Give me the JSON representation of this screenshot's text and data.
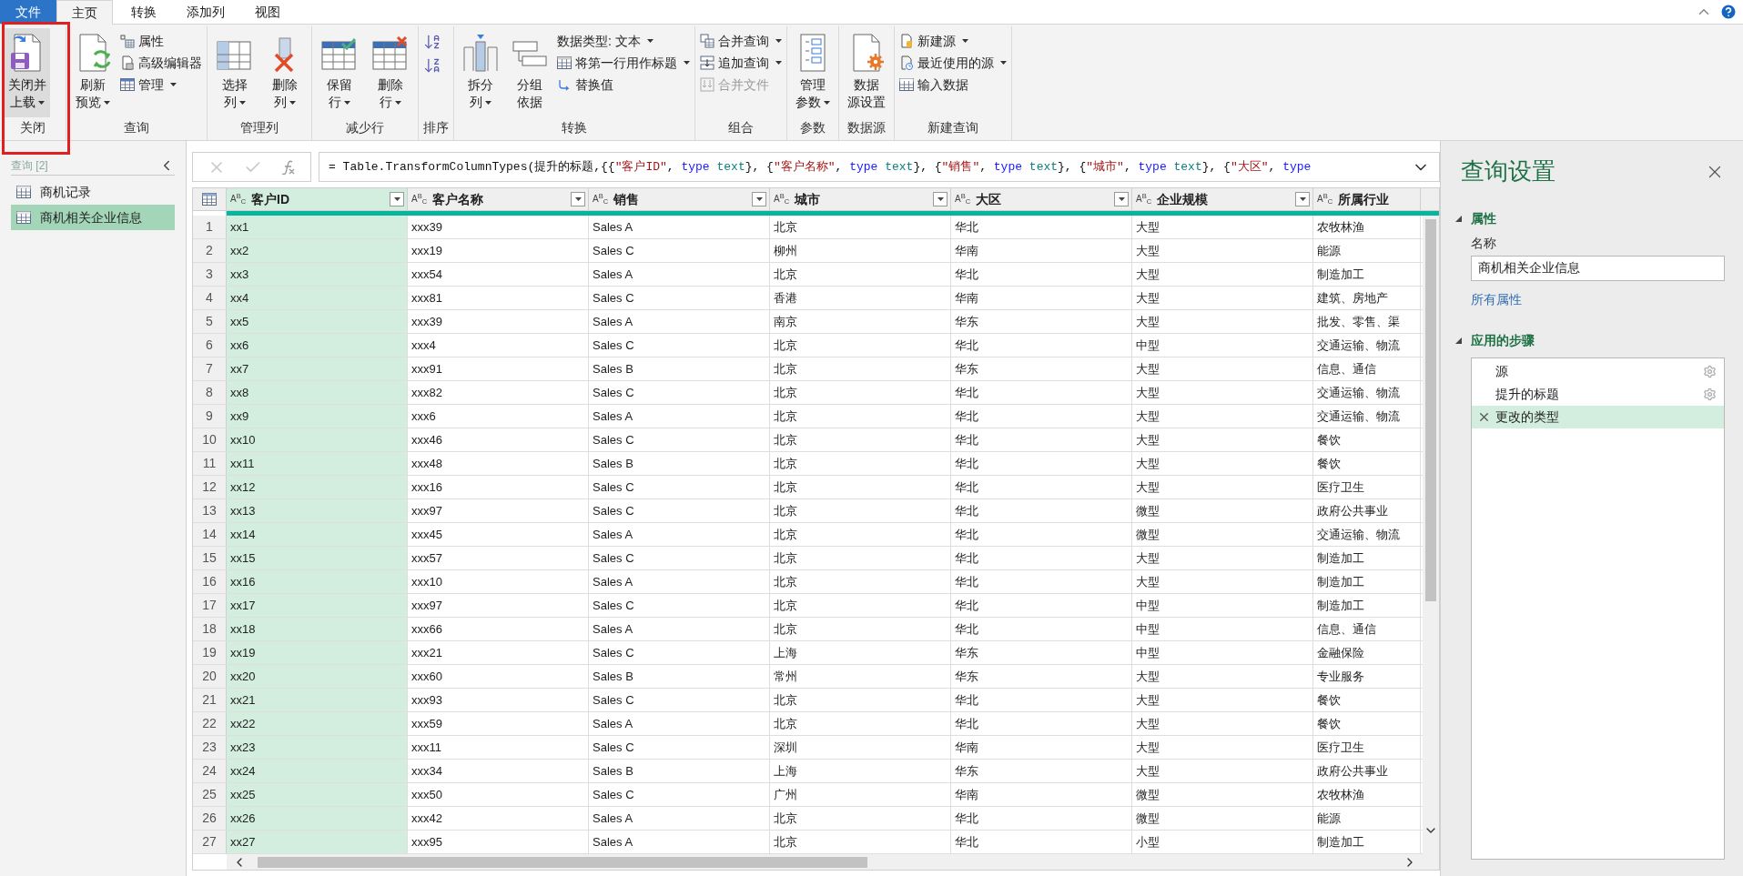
{
  "tabs": [
    {
      "label": "文件",
      "kind": "file",
      "selected": false
    },
    {
      "label": "主页",
      "kind": "tab",
      "selected": true
    },
    {
      "label": "转换",
      "kind": "tab",
      "selected": false
    },
    {
      "label": "添加列",
      "kind": "tab",
      "selected": false
    },
    {
      "label": "视图",
      "kind": "tab",
      "selected": false
    }
  ],
  "ribbon": {
    "groups": [
      {
        "label": "关闭",
        "items": [
          {
            "kind": "large",
            "lines": [
              "关闭并",
              "上载"
            ],
            "dropdown": true,
            "disabled": false
          }
        ]
      },
      {
        "label": "查询",
        "items": [
          {
            "kind": "large",
            "lines": [
              "刷新",
              "预览"
            ],
            "dropdown": true,
            "disabled": false
          },
          {
            "kind": "small",
            "label": "属性",
            "dropdown": false,
            "disabled": false
          },
          {
            "kind": "small",
            "label": "高级编辑器",
            "dropdown": false,
            "disabled": false
          },
          {
            "kind": "small",
            "label": "管理",
            "dropdown": true,
            "disabled": false
          }
        ]
      },
      {
        "label": "管理列",
        "items": [
          {
            "kind": "large",
            "lines": [
              "选择",
              "列"
            ],
            "dropdown": true,
            "disabled": false
          },
          {
            "kind": "large",
            "lines": [
              "删除",
              "列"
            ],
            "dropdown": true,
            "disabled": false
          }
        ]
      },
      {
        "label": "减少行",
        "items": [
          {
            "kind": "large",
            "lines": [
              "保留",
              "行"
            ],
            "dropdown": true,
            "disabled": false
          },
          {
            "kind": "large",
            "lines": [
              "删除",
              "行"
            ],
            "dropdown": true,
            "disabled": false
          }
        ]
      },
      {
        "label": "排序",
        "items": [
          {
            "kind": "icon",
            "disabled": false
          },
          {
            "kind": "icon",
            "disabled": false
          }
        ]
      },
      {
        "label": "转换",
        "items": [
          {
            "kind": "large",
            "lines": [
              "拆分",
              "列"
            ],
            "dropdown": true,
            "disabled": false
          },
          {
            "kind": "large",
            "lines": [
              "分组",
              "依据"
            ],
            "dropdown": false,
            "disabled": false
          },
          {
            "kind": "small",
            "label": "数据类型: 文本",
            "dropdown": true,
            "disabled": false
          },
          {
            "kind": "small",
            "label": "将第一行用作标题",
            "dropdown": true,
            "disabled": false
          },
          {
            "kind": "small",
            "label": "替换值",
            "dropdown": false,
            "disabled": false
          }
        ]
      },
      {
        "label": "组合",
        "items": [
          {
            "kind": "small",
            "label": "合并查询",
            "dropdown": true,
            "disabled": false
          },
          {
            "kind": "small",
            "label": "追加查询",
            "dropdown": true,
            "disabled": false
          },
          {
            "kind": "small",
            "label": "合并文件",
            "dropdown": false,
            "disabled": true
          }
        ]
      },
      {
        "label": "参数",
        "items": [
          {
            "kind": "large",
            "lines": [
              "管理",
              "参数"
            ],
            "dropdown": true,
            "disabled": false
          }
        ]
      },
      {
        "label": "数据源",
        "items": [
          {
            "kind": "large",
            "lines": [
              "数据",
              "源设置"
            ],
            "dropdown": false,
            "disabled": false
          }
        ]
      },
      {
        "label": "新建查询",
        "items": [
          {
            "kind": "small",
            "label": "新建源",
            "dropdown": true,
            "disabled": false
          },
          {
            "kind": "small",
            "label": "最近使用的源",
            "dropdown": true,
            "disabled": false
          },
          {
            "kind": "small",
            "label": "输入数据",
            "dropdown": false,
            "disabled": false
          }
        ]
      }
    ]
  },
  "queries": {
    "header": "查询 [2]",
    "items": [
      {
        "label": "商机记录",
        "selected": false
      },
      {
        "label": "商机相关企业信息",
        "selected": true
      }
    ]
  },
  "formula": {
    "tokens": [
      {
        "kind": "plain",
        "text": "= Table.TransformColumnTypes(提升的标题,{{"
      },
      {
        "kind": "string",
        "text": "\"客户ID\""
      },
      {
        "kind": "plain",
        "text": ", "
      },
      {
        "kind": "keyword",
        "text": "type"
      },
      {
        "kind": "type",
        "text": " text"
      },
      {
        "kind": "plain",
        "text": "}, {"
      },
      {
        "kind": "string",
        "text": "\"客户名称\""
      },
      {
        "kind": "plain",
        "text": ", "
      },
      {
        "kind": "keyword",
        "text": "type"
      },
      {
        "kind": "type",
        "text": " text"
      },
      {
        "kind": "plain",
        "text": "}, {"
      },
      {
        "kind": "string",
        "text": "\"销售\""
      },
      {
        "kind": "plain",
        "text": ", "
      },
      {
        "kind": "keyword",
        "text": "type"
      },
      {
        "kind": "type",
        "text": " text"
      },
      {
        "kind": "plain",
        "text": "}, {"
      },
      {
        "kind": "string",
        "text": "\"城市\""
      },
      {
        "kind": "plain",
        "text": ", "
      },
      {
        "kind": "keyword",
        "text": "type"
      },
      {
        "kind": "type",
        "text": " text"
      },
      {
        "kind": "plain",
        "text": "}, {"
      },
      {
        "kind": "string",
        "text": "\"大区\""
      },
      {
        "kind": "plain",
        "text": ", "
      },
      {
        "kind": "keyword",
        "text": "type"
      }
    ]
  },
  "table": {
    "columns": [
      {
        "type_label": "A$^{B}$$_{C}$",
        "name": "客户ID",
        "selected": true
      },
      {
        "type_label": "A$^{B}$$_{C}$",
        "name": "客户名称",
        "selected": false
      },
      {
        "type_label": "A$^{B}$$_{C}$",
        "name": "销售",
        "selected": false
      },
      {
        "type_label": "A$^{B}$$_{C}$",
        "name": "城市",
        "selected": false
      },
      {
        "type_label": "A$^{B}$$_{C}$",
        "name": "大区",
        "selected": false
      },
      {
        "type_label": "A$^{B}$$_{C}$",
        "name": "企业规模",
        "selected": false
      },
      {
        "type_label": "A$^{B}$$_{C}$",
        "name": "所属行业",
        "selected": false
      }
    ],
    "rows": [
      {
        "number": "1",
        "cells": [
          "xx1",
          "xxx39",
          "Sales A",
          "北京",
          "华北",
          "大型",
          "农牧林渔"
        ]
      },
      {
        "number": "2",
        "cells": [
          "xx2",
          "xxx19",
          "Sales C",
          "柳州",
          "华南",
          "大型",
          "能源"
        ]
      },
      {
        "number": "3",
        "cells": [
          "xx3",
          "xxx54",
          "Sales A",
          "北京",
          "华北",
          "大型",
          "制造加工"
        ]
      },
      {
        "number": "4",
        "cells": [
          "xx4",
          "xxx81",
          "Sales C",
          "香港",
          "华南",
          "大型",
          "建筑、房地产"
        ]
      },
      {
        "number": "5",
        "cells": [
          "xx5",
          "xxx39",
          "Sales A",
          "南京",
          "华东",
          "大型",
          "批发、零售、渠"
        ]
      },
      {
        "number": "6",
        "cells": [
          "xx6",
          "xxx4",
          "Sales C",
          "北京",
          "华北",
          "中型",
          "交通运输、物流"
        ]
      },
      {
        "number": "7",
        "cells": [
          "xx7",
          "xxx91",
          "Sales B",
          "北京",
          "华东",
          "大型",
          "信息、通信"
        ]
      },
      {
        "number": "8",
        "cells": [
          "xx8",
          "xxx82",
          "Sales C",
          "北京",
          "华北",
          "大型",
          "交通运输、物流"
        ]
      },
      {
        "number": "9",
        "cells": [
          "xx9",
          "xxx6",
          "Sales A",
          "北京",
          "华北",
          "大型",
          "交通运输、物流"
        ]
      },
      {
        "number": "10",
        "cells": [
          "xx10",
          "xxx46",
          "Sales C",
          "北京",
          "华北",
          "大型",
          "餐饮"
        ]
      },
      {
        "number": "11",
        "cells": [
          "xx11",
          "xxx48",
          "Sales B",
          "北京",
          "华北",
          "大型",
          "餐饮"
        ]
      },
      {
        "number": "12",
        "cells": [
          "xx12",
          "xxx16",
          "Sales C",
          "北京",
          "华北",
          "大型",
          "医疗卫生"
        ]
      },
      {
        "number": "13",
        "cells": [
          "xx13",
          "xxx97",
          "Sales C",
          "北京",
          "华北",
          "微型",
          "政府公共事业"
        ]
      },
      {
        "number": "14",
        "cells": [
          "xx14",
          "xxx45",
          "Sales A",
          "北京",
          "华北",
          "微型",
          "交通运输、物流"
        ]
      },
      {
        "number": "15",
        "cells": [
          "xx15",
          "xxx57",
          "Sales C",
          "北京",
          "华北",
          "大型",
          "制造加工"
        ]
      },
      {
        "number": "16",
        "cells": [
          "xx16",
          "xxx10",
          "Sales A",
          "北京",
          "华北",
          "大型",
          "制造加工"
        ]
      },
      {
        "number": "17",
        "cells": [
          "xx17",
          "xxx97",
          "Sales C",
          "北京",
          "华北",
          "中型",
          "制造加工"
        ]
      },
      {
        "number": "18",
        "cells": [
          "xx18",
          "xxx66",
          "Sales A",
          "北京",
          "华北",
          "中型",
          "信息、通信"
        ]
      },
      {
        "number": "19",
        "cells": [
          "xx19",
          "xxx21",
          "Sales C",
          "上海",
          "华东",
          "中型",
          "金融保险"
        ]
      },
      {
        "number": "20",
        "cells": [
          "xx20",
          "xxx60",
          "Sales B",
          "常州",
          "华东",
          "大型",
          "专业服务"
        ]
      },
      {
        "number": "21",
        "cells": [
          "xx21",
          "xxx93",
          "Sales C",
          "北京",
          "华北",
          "大型",
          "餐饮"
        ]
      },
      {
        "number": "22",
        "cells": [
          "xx22",
          "xxx59",
          "Sales A",
          "北京",
          "华北",
          "大型",
          "餐饮"
        ]
      },
      {
        "number": "23",
        "cells": [
          "xx23",
          "xxx11",
          "Sales C",
          "深圳",
          "华南",
          "大型",
          "医疗卫生"
        ]
      },
      {
        "number": "24",
        "cells": [
          "xx24",
          "xxx34",
          "Sales B",
          "上海",
          "华东",
          "大型",
          "政府公共事业"
        ]
      },
      {
        "number": "25",
        "cells": [
          "xx25",
          "xxx50",
          "Sales C",
          "广州",
          "华南",
          "微型",
          "农牧林渔"
        ]
      },
      {
        "number": "26",
        "cells": [
          "xx26",
          "xxx42",
          "Sales A",
          "北京",
          "华北",
          "微型",
          "能源"
        ]
      },
      {
        "number": "27",
        "cells": [
          "xx27",
          "xxx95",
          "Sales A",
          "北京",
          "华北",
          "小型",
          "制造加工"
        ]
      }
    ]
  },
  "settings": {
    "title": "查询设置",
    "properties": {
      "heading": "属性",
      "name_label": "名称",
      "name_value": "商机相关企业信息",
      "link": "所有属性"
    },
    "steps": {
      "heading": "应用的步骤",
      "items": [
        {
          "label": "源",
          "selected": false,
          "settings": true
        },
        {
          "label": "提升的标题",
          "selected": false,
          "settings": true
        },
        {
          "label": "更改的类型",
          "selected": true,
          "settings": false
        }
      ]
    }
  }
}
